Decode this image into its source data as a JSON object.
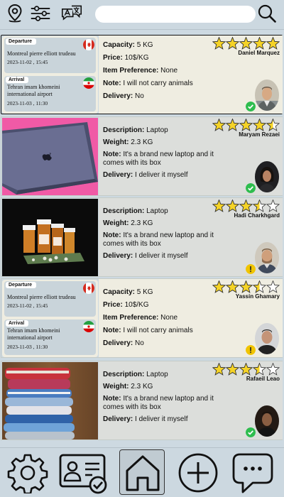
{
  "search": {
    "placeholder": ""
  },
  "icons": {
    "top": [
      "location-pin-icon",
      "sliders-filter-icon",
      "translate-icon",
      "search-icon"
    ],
    "bottom": [
      "gear-icon",
      "profile-card-icon",
      "home-icon",
      "plus-icon",
      "chat-icon"
    ]
  },
  "colors": {
    "accent_bg": "#ccd8e0",
    "star": "#f5d327",
    "verified": "#2ebd4e",
    "pending": "#f0c400"
  },
  "labels": {
    "departure": "Departure",
    "arrival": "Arrival",
    "capacity": "Capacity:",
    "price": "Price:",
    "item_preference": "Item Preference:",
    "note": "Note:",
    "delivery": "Delivery:",
    "description": "Description:",
    "weight": "Weight:"
  },
  "cards": [
    {
      "type": "trip",
      "departure": {
        "place": "Montreal pierre elliott trudeau",
        "datetime": "2023-11-02 , 15:45",
        "flag": "canada-flag"
      },
      "arrival": {
        "place": "Tehran imam khomeini international airport",
        "datetime": "2023-11-03 , 11:30",
        "flag": "iran-flag"
      },
      "capacity": "5 KG",
      "price": "10$/KG",
      "item_preference": "None",
      "note": "I will not carry animals",
      "delivery": "No",
      "user": "Daniel Marquez",
      "rating": 5,
      "status": "verified"
    },
    {
      "type": "item",
      "photo": "laptop",
      "description": "Laptop",
      "weight": "2.3 KG",
      "note": "It's a brand new laptop and it comes with its box",
      "delivery": "I deliver it myself",
      "user": "Maryam Rezaei",
      "rating": 4.5,
      "status": "verified"
    },
    {
      "type": "item",
      "photo": "pill-bottles",
      "description": "Laptop",
      "weight": "2.3 KG",
      "note": "It's a brand new laptop and it comes with its box",
      "delivery": "I deliver it myself",
      "user": "Hadi Charkhgard",
      "rating": 3.5,
      "status": "pending"
    },
    {
      "type": "trip",
      "departure": {
        "place": "Montreal pierre elliott trudeau",
        "datetime": "2023-11-02 , 15:45",
        "flag": "canada-flag"
      },
      "arrival": {
        "place": "Tehran imam khomeini international airport",
        "datetime": "2023-11-03 , 11:30",
        "flag": "iran-flag"
      },
      "capacity": "5 KG",
      "price": "10$/KG",
      "item_preference": "None",
      "note": "I will not carry animals",
      "delivery": "No",
      "user": "Yassin Ghamary",
      "rating": 3.5,
      "status": "pending"
    },
    {
      "type": "item",
      "photo": "folded-clothes",
      "description": "Laptop",
      "weight": "2.3 KG",
      "note": "It's a brand new laptop and it comes with its box",
      "delivery": "I deliver it myself",
      "user": "Rafaeil Leao",
      "rating": 3.5,
      "status": "verified"
    }
  ]
}
